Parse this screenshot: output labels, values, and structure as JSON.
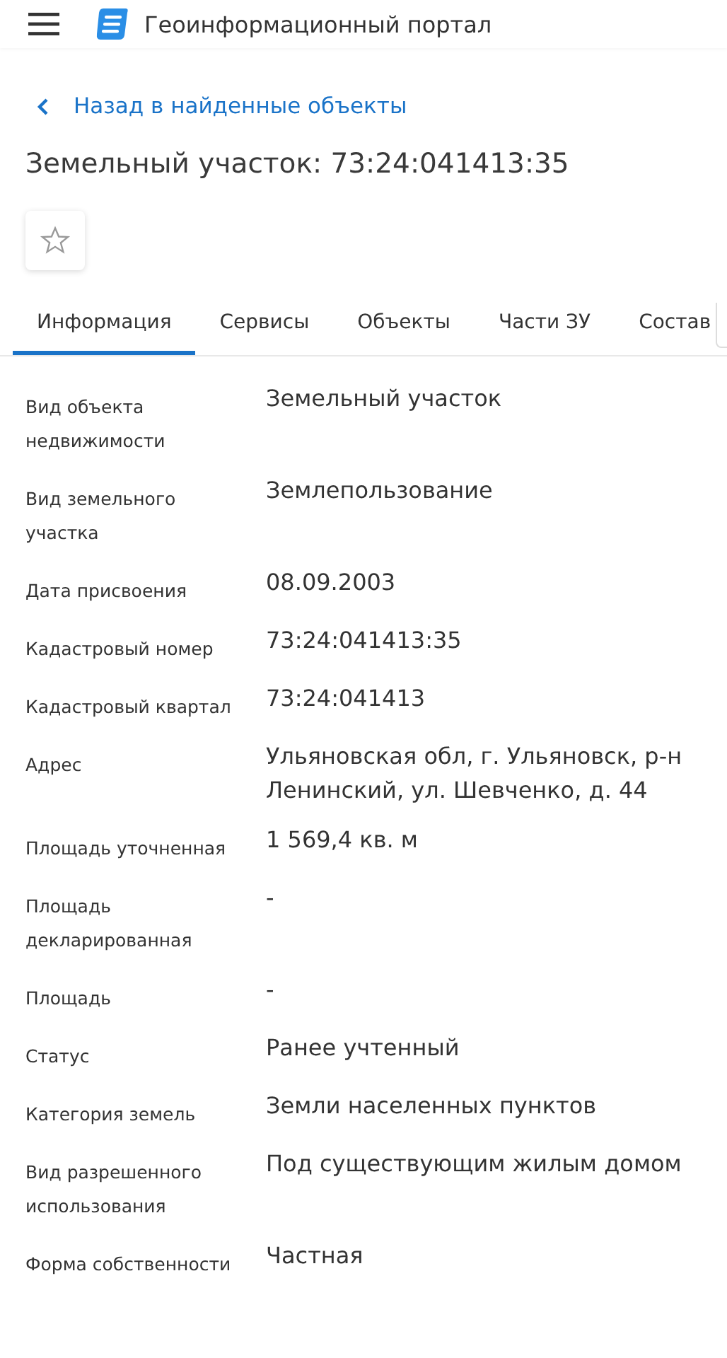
{
  "header": {
    "title": "Геоинформационный портал"
  },
  "back_link": {
    "label": "Назад в найденные объекты"
  },
  "title": "Земельный участок: 73:24:041413:35",
  "favorite": {
    "on": false
  },
  "tabs": [
    {
      "label": "Информация",
      "selected": true
    },
    {
      "label": "Сервисы",
      "selected": false
    },
    {
      "label": "Объекты",
      "selected": false
    },
    {
      "label": "Части ЗУ",
      "selected": false
    },
    {
      "label": "Состав",
      "selected": false
    }
  ],
  "rows": [
    {
      "label": "Вид объекта недвижимости",
      "value": "Земельный участок"
    },
    {
      "label": "Вид земельного участка",
      "value": "Землепользование"
    },
    {
      "label": "Дата присвоения",
      "value": "08.09.2003"
    },
    {
      "label": "Кадастровый номер",
      "value": "73:24:041413:35"
    },
    {
      "label": "Кадастровый квартал",
      "value": "73:24:041413"
    },
    {
      "label": "Адрес",
      "value": "Ульяновская обл, г. Ульяновск, р-н Ленинский, ул. Шевченко, д. 44"
    },
    {
      "label": "Площадь уточненная",
      "value": "1 569,4 кв. м"
    },
    {
      "label": "Площадь декларированная",
      "value": "-"
    },
    {
      "label": "Площадь",
      "value": "-"
    },
    {
      "label": "Статус",
      "value": "Ранее учтенный"
    },
    {
      "label": "Категория земель",
      "value": "Земли населенных пунктов"
    },
    {
      "label": "Вид разрешенного использования",
      "value": "Под существующим жилым домом"
    },
    {
      "label": "Форма собственности",
      "value": "Частная"
    }
  ]
}
